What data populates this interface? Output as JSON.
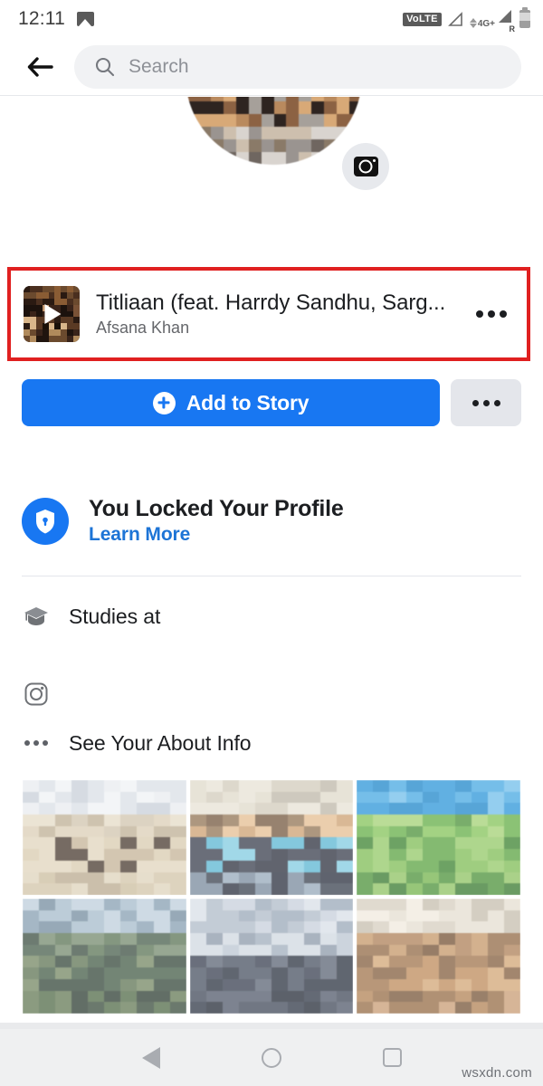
{
  "status_bar": {
    "clock": "12:11",
    "photo_icon": "image-icon",
    "volte_label": "VoLTE",
    "signal_icon": "signal-triangle-icon",
    "network_gen": "4G+",
    "roaming_label": "R",
    "battery_icon": "battery-icon"
  },
  "header": {
    "back_icon": "back-arrow-icon",
    "search_icon": "search-icon",
    "search_value": "",
    "search_placeholder": "Search"
  },
  "profile": {
    "avatar_alt": "profile-photo",
    "camera_icon": "camera-icon"
  },
  "music_card": {
    "highlight_color": "#e02020",
    "album_art_icon": "play-icon",
    "title": "Titliaan (feat. Harrdy Sandhu, Sarg...",
    "artist": "Afsana Khan",
    "overflow_icon": "more-horizontal-icon"
  },
  "actions": {
    "story_label": "Add to Story",
    "story_icon": "plus-circle-icon",
    "story_color": "#1877f2",
    "more_icon": "more-horizontal-icon",
    "more_color": "#e4e6eb"
  },
  "locked": {
    "badge_icon": "shield-lock-icon",
    "badge_color": "#1877f2",
    "title": "You Locked Your Profile",
    "link_label": "Learn More",
    "link_color": "#1d74d6"
  },
  "info_rows": [
    {
      "icon": "graduation-cap-icon",
      "label": "Studies at"
    },
    {
      "icon": "instagram-icon",
      "label": ""
    },
    {
      "icon": "more-horizontal-icon",
      "label": "See Your About Info"
    }
  ],
  "photo_grid": {
    "cells": [
      {
        "alt": "photo-1"
      },
      {
        "alt": "photo-2"
      },
      {
        "alt": "photo-3"
      },
      {
        "alt": "photo-4"
      },
      {
        "alt": "photo-5"
      },
      {
        "alt": "photo-6"
      }
    ]
  },
  "nav_bar": {
    "back_icon": "nav-back-icon",
    "home_icon": "nav-home-icon",
    "recents_icon": "nav-recents-icon"
  },
  "watermark": "wsxdn.com"
}
